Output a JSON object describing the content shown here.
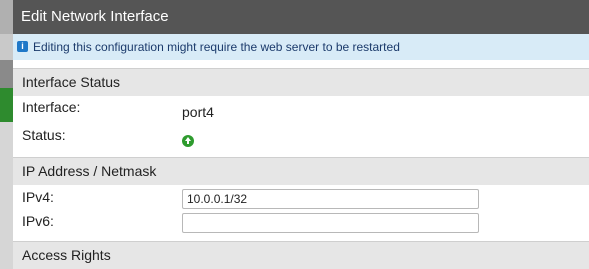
{
  "dialog": {
    "title": "Edit Network Interface",
    "info_banner": "Editing this configuration might require the web server to be restarted",
    "info_icon": "info-icon"
  },
  "interface_status": {
    "header": "Interface Status",
    "interface_label": "Interface:",
    "interface_value": "port4",
    "status_label": "Status:",
    "status_icon": "status-up-icon",
    "status_color": "#2e9b2e"
  },
  "ip_netmask": {
    "header": "IP Address / Netmask",
    "ipv4_label": "IPv4:",
    "ipv4_value": "10.0.0.1/32",
    "ipv6_label": "IPv6:",
    "ipv6_value": ""
  },
  "access_rights": {
    "header": "Access Rights"
  }
}
